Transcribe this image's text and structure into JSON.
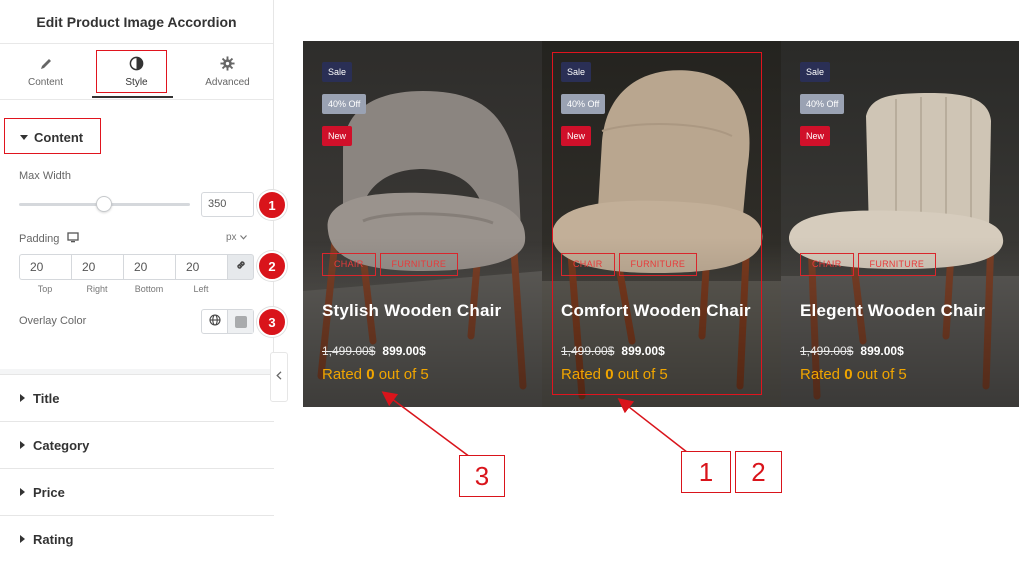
{
  "panel": {
    "title": "Edit Product Image Accordion",
    "tabs": [
      {
        "label": "Content",
        "icon": "pencil-icon"
      },
      {
        "label": "Style",
        "icon": "contrast-icon"
      },
      {
        "label": "Advanced",
        "icon": "gear-icon"
      }
    ],
    "active_tab": "Style",
    "content_section": {
      "label": "Content",
      "max_width": {
        "label": "Max Width",
        "value": "350",
        "slider_fraction": 0.5
      },
      "padding": {
        "label": "Padding",
        "unit": "px",
        "values": [
          "20",
          "20",
          "20",
          "20"
        ],
        "sides": [
          "Top",
          "Right",
          "Bottom",
          "Left"
        ]
      },
      "overlay_color": {
        "label": "Overlay Color"
      }
    },
    "sections": [
      "Title",
      "Category",
      "Price",
      "Rating"
    ]
  },
  "markers": [
    "1",
    "2",
    "3"
  ],
  "preview": {
    "products": [
      {
        "badges": [
          "Sale",
          "40% Off",
          "New"
        ],
        "categories": [
          "CHAIR",
          "FURNITURE"
        ],
        "title": "Stylish Wooden Chair",
        "old_price": "1,499.00$",
        "price": "899.00$",
        "rating_prefix": "Rated",
        "rating_value": "0",
        "rating_suffix": "out of 5"
      },
      {
        "badges": [
          "Sale",
          "40% Off",
          "New"
        ],
        "categories": [
          "CHAIR",
          "FURNITURE"
        ],
        "title": "Comfort Wooden Chair",
        "old_price": "1,499.00$",
        "price": "899.00$",
        "rating_prefix": "Rated",
        "rating_value": "0",
        "rating_suffix": "out of 5"
      },
      {
        "badges": [
          "Sale",
          "40% Off",
          "New"
        ],
        "categories": [
          "CHAIR",
          "FURNITURE"
        ],
        "title": "Elegent Wooden Chair",
        "old_price": "1,499.00$",
        "price": "899.00$",
        "rating_prefix": "Rated",
        "rating_value": "0",
        "rating_suffix": "out of 5"
      }
    ]
  },
  "callouts": [
    "3",
    "1",
    "2"
  ],
  "colors": {
    "accent_red": "#d9141b",
    "rating": "#f0a500",
    "sale": "#2a2f55",
    "discount": "#9aa2b3",
    "new": "#d0102a"
  }
}
